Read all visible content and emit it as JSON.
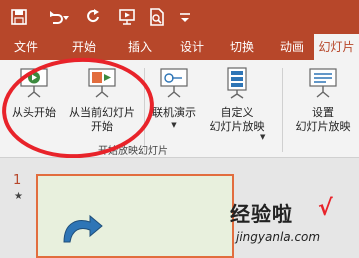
{
  "quick_access": {
    "icons": [
      "save-icon",
      "undo-icon",
      "undo-dropdown-icon",
      "redo-icon",
      "from-beginning-icon",
      "print-preview-icon",
      "customize-icon"
    ]
  },
  "tabs": [
    {
      "label": "文件"
    },
    {
      "label": "开始"
    },
    {
      "label": "插入"
    },
    {
      "label": "设计"
    },
    {
      "label": "切换"
    },
    {
      "label": "动画"
    },
    {
      "label": "幻灯片"
    }
  ],
  "ribbon": {
    "from_beginning": "从头开始",
    "from_current_line1": "从当前幻灯片",
    "from_current_line2": "开始",
    "online_present": "联机演示",
    "custom_show_line1": "自定义",
    "custom_show_line2": "幻灯片放映",
    "setup_line1": "设置",
    "setup_line2": "幻灯片放映",
    "group_label": "开始放映幻灯片"
  },
  "slides": {
    "number": "1",
    "star": "★"
  },
  "watermark": {
    "text": "经验啦",
    "check": "√",
    "url": "jingyanla.com"
  },
  "colors": {
    "accent": "#b7472a",
    "highlight_ring": "#e8232a"
  }
}
